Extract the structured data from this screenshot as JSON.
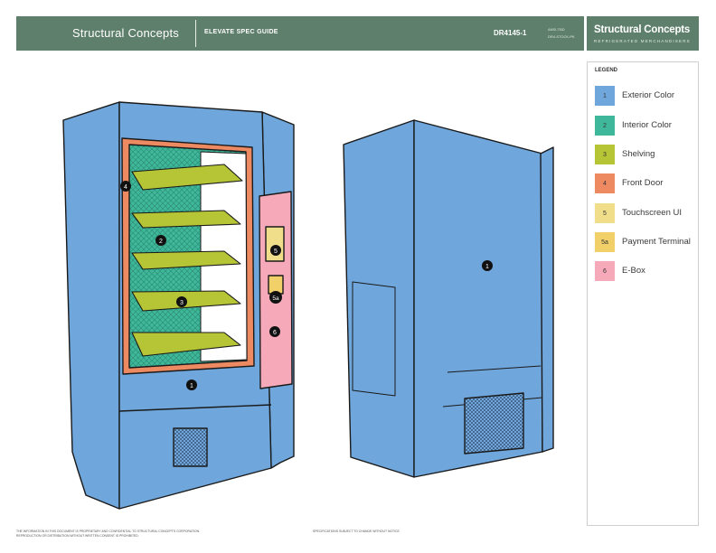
{
  "header": {
    "brand": "Structural Concepts",
    "doc_title": "ELEVATE SPEC GUIDE",
    "model": "DR4145-1",
    "meta_line1": "ANSI-TBD",
    "meta_line2": "DR4-STOCK-PK"
  },
  "logo": {
    "name": "Structural Concepts",
    "tagline": "REFRIGERATED MERCHANDISERS"
  },
  "legend": {
    "title": "LEGEND",
    "items": [
      {
        "key": "1",
        "label": "Exterior Color",
        "color": "#6fa6dc"
      },
      {
        "key": "2",
        "label": "Interior Color",
        "color": "#3fb79a"
      },
      {
        "key": "3",
        "label": "Shelving",
        "color": "#b6c536"
      },
      {
        "key": "4",
        "label": "Front Door",
        "color": "#ee8a62"
      },
      {
        "key": "5",
        "label": "Touchscreen UI",
        "color": "#f0de8a"
      },
      {
        "key": "5a",
        "label": "Payment Terminal",
        "color": "#f1d06a"
      },
      {
        "key": "6",
        "label": "E-Box",
        "color": "#f6a9b9"
      }
    ]
  },
  "callouts": {
    "front_door": "4",
    "interior": "2",
    "shelving": "3",
    "touchscreen": "5",
    "payment": "5a",
    "ebox": "6",
    "exterior_front": "1",
    "exterior_back": "1"
  },
  "footer": {
    "left_line1": "THE INFORMATION IN THIS DOCUMENT IS PROPRIETARY AND CONFIDENTIAL TO STRUCTURAL CONCEPTS CORPORATION.",
    "left_line2": "REPRODUCTION OR DISTRIBUTION WITHOUT WRITTEN CONSENT IS PROHIBITED.",
    "right_line1": "SPECIFICATIONS SUBJECT TO CHANGE WITHOUT NOTICE"
  }
}
